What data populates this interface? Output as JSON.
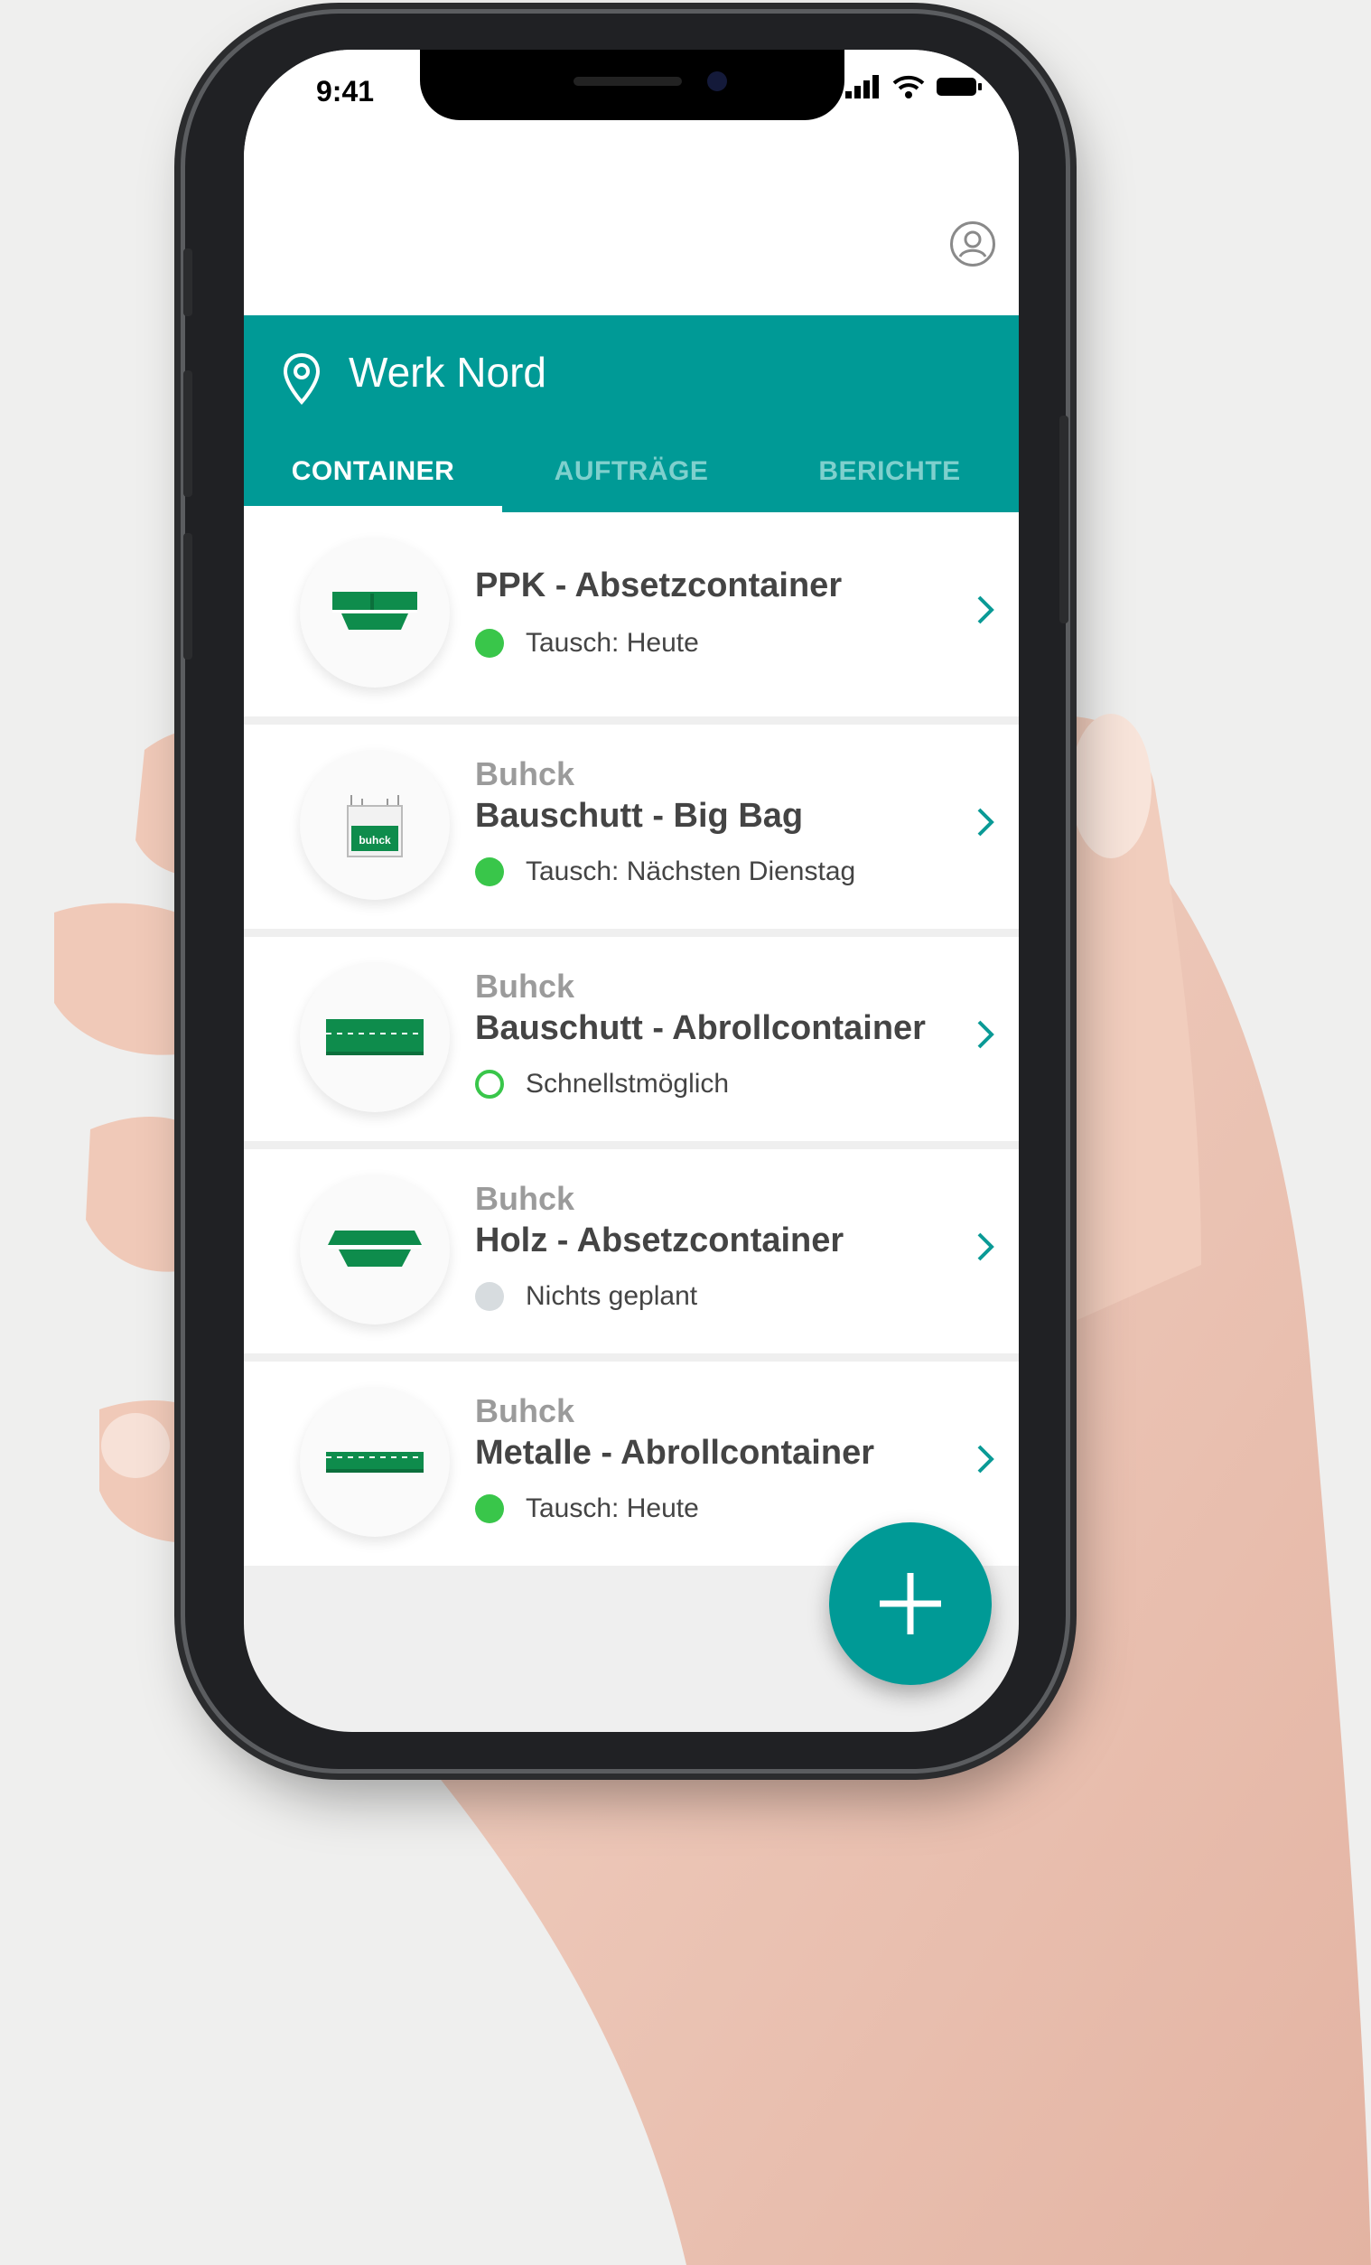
{
  "status_bar": {
    "time": "9:41"
  },
  "header": {
    "location": "Werk Nord"
  },
  "tabs": [
    {
      "label": "CONTAINER",
      "active": true
    },
    {
      "label": "AUFTRÄGE",
      "active": false
    },
    {
      "label": "BERICHTE",
      "active": false
    }
  ],
  "containers": [
    {
      "brand": "",
      "title": "PPK - Absetzcontainer",
      "status": "Tausch: Heute",
      "status_type": "green-filled",
      "icon": "absetzcontainer-icon"
    },
    {
      "brand": "Buhck",
      "title": "Bauschutt - Big Bag",
      "status": "Tausch: Nächsten Dienstag",
      "status_type": "green-filled",
      "icon": "big-bag-icon"
    },
    {
      "brand": "Buhck",
      "title": "Bauschutt - Abrollcontainer",
      "status": "Schnellstmöglich",
      "status_type": "green-outline",
      "icon": "abrollcontainer-icon"
    },
    {
      "brand": "Buhck",
      "title": "Holz - Absetzcontainer",
      "status": "Nichts geplant",
      "status_type": "grey",
      "icon": "absetzcontainer-icon"
    },
    {
      "brand": "Buhck",
      "title": "Metalle - Abrollcontainer",
      "status": "Tausch: Heute",
      "status_type": "green-filled",
      "icon": "abrollcontainer-icon"
    }
  ],
  "big_bag_logo_text": "buhck",
  "colors": {
    "accent": "#009a96",
    "green": "#39c64a",
    "grey_dot": "#d7dcdf",
    "container_green": "#0e8c4c"
  }
}
